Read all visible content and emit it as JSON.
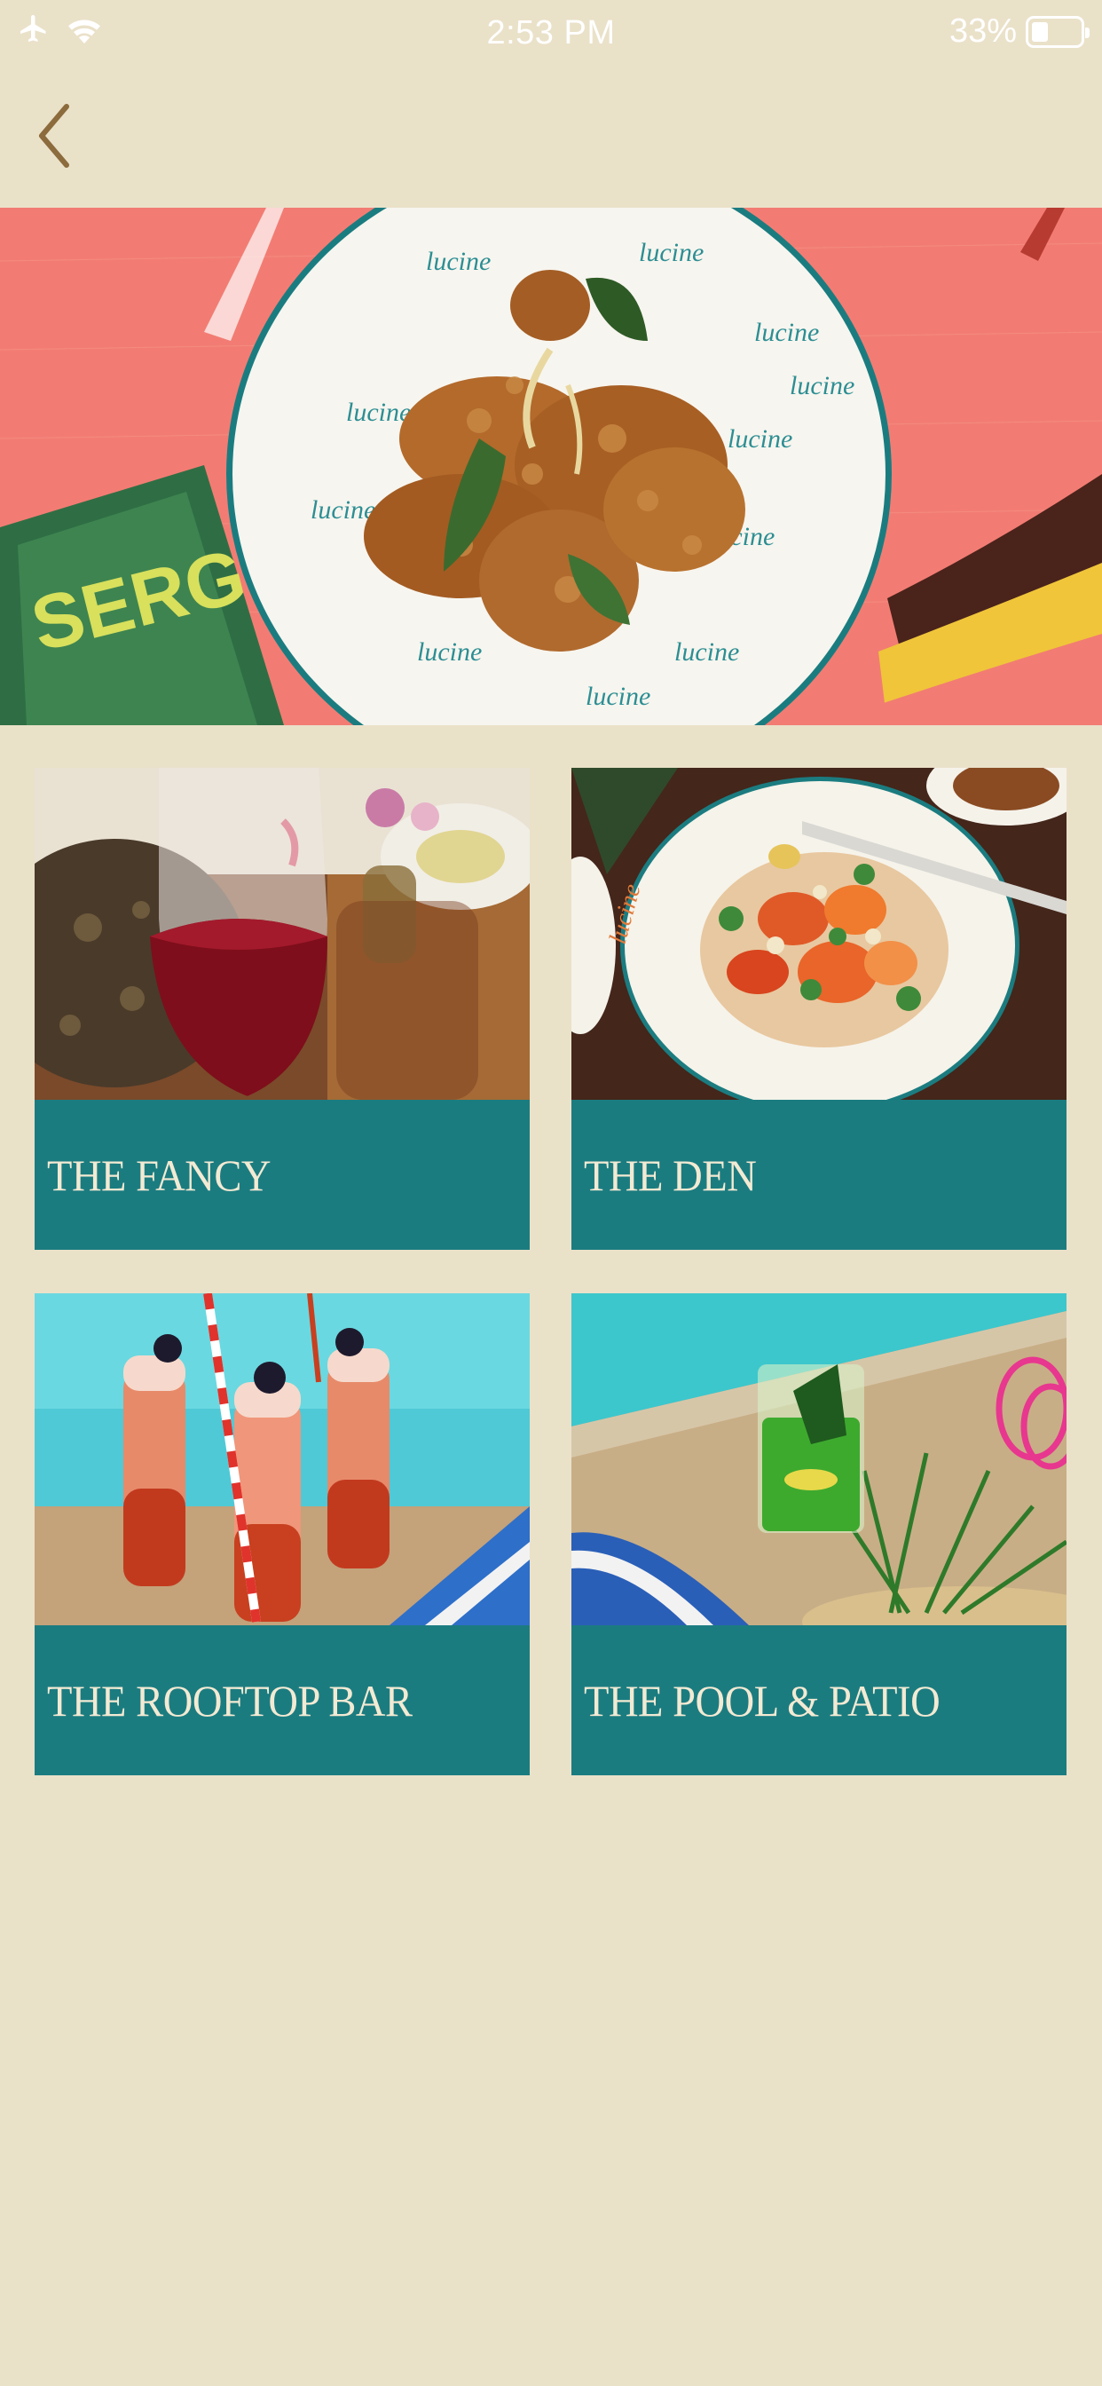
{
  "status_bar": {
    "time": "2:53 PM",
    "battery_percent": "33%",
    "battery_level": 0.33,
    "icons": [
      "airplane-icon",
      "wifi-icon",
      "battery-icon"
    ],
    "color": "#FFFFFF"
  },
  "header": {
    "back_icon": "chevron-left-icon",
    "back_color": "#8C6B3C"
  },
  "hero": {
    "image": "fried-chicken-plate-photo",
    "plate_text": "lucine",
    "magazine_text": "SERGIO"
  },
  "venues": [
    {
      "label": "THE FANCY",
      "image": "red-wine-glass-photo"
    },
    {
      "label": "THE DEN",
      "image": "salad-bowl-photo"
    },
    {
      "label": "THE ROOFTOP BAR",
      "image": "tiki-cocktails-photo"
    },
    {
      "label": "THE POOL & PATIO",
      "image": "green-cocktail-poolside-photo"
    }
  ],
  "colors": {
    "background": "#EAE1C9",
    "card_label_bg": "#1B7C80",
    "card_label_text": "#F3EAD3"
  }
}
